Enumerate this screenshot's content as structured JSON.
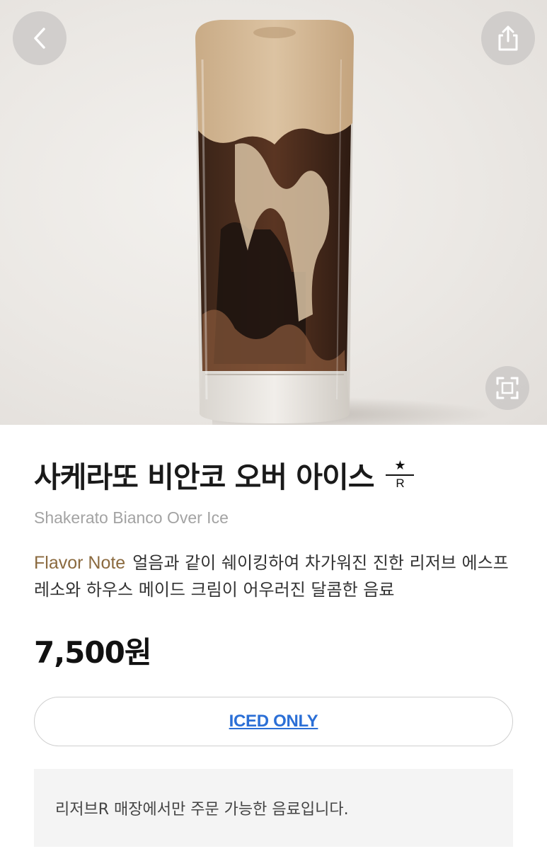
{
  "product": {
    "name_ko": "사케라또 비안코 오버 아이스",
    "name_en": "Shakerato Bianco Over Ice",
    "reserve_badge_letter": "R",
    "flavor_label": "Flavor Note",
    "flavor_text": "얼음과 같이 쉐이킹하여 차가워진 진한 리저브 에스프레소와 하우스 메이드 크림이 어우러진 달콤한 음료",
    "price": "7,500원",
    "temperature": "ICED ONLY",
    "notice": "리저브R 매장에서만 주문 가능한 음료입니다."
  },
  "icons": {
    "back": "chevron-left-icon",
    "share": "share-icon",
    "zoom": "expand-icon",
    "reserve": "reserve-star-icon"
  },
  "colors": {
    "flavor_label": "#8b6a3f",
    "temperature_link": "#2b6fd6",
    "subtitle": "#a3a3a3",
    "notice_bg": "#f4f4f4"
  }
}
